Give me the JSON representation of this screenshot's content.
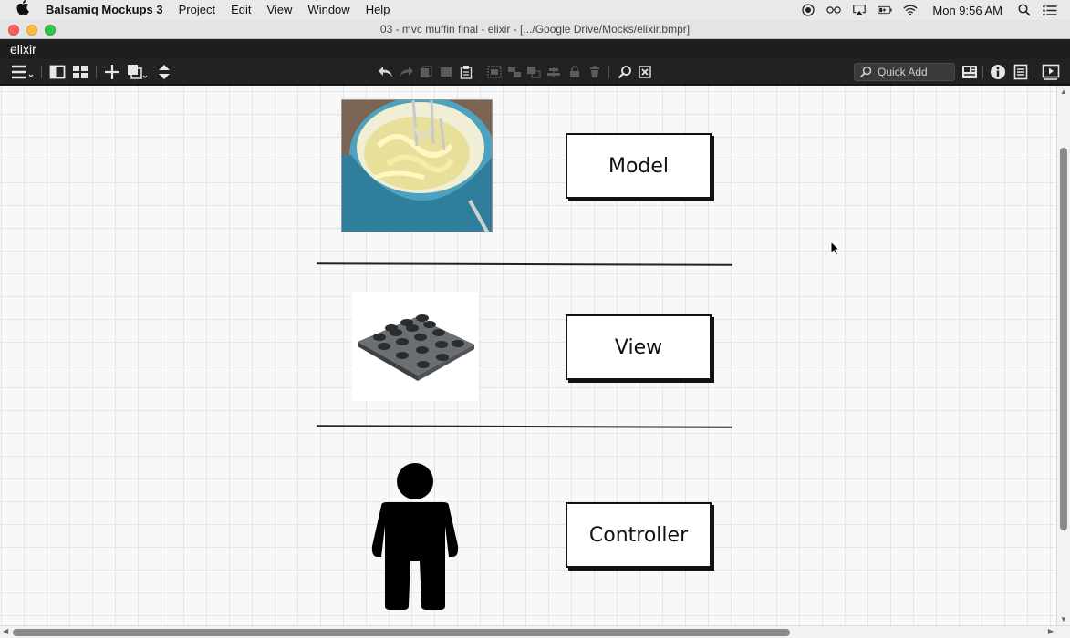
{
  "menubar": {
    "app_name": "Balsamiq Mockups 3",
    "items": [
      "Project",
      "Edit",
      "View",
      "Window",
      "Help"
    ],
    "clock": "Mon 9:56 AM",
    "status_icons": [
      "record-icon",
      "glasses-icon",
      "airplay-icon",
      "battery-icon",
      "wifi-icon",
      "spotlight-icon",
      "notification-center-icon"
    ]
  },
  "window": {
    "title": "03 - mvc muffin final - elixir - [.../Google Drive/Mocks/elixir.bmpr]"
  },
  "project": {
    "name": "elixir"
  },
  "toolbar": {
    "quick_add_placeholder": "Quick Add"
  },
  "mockup": {
    "boxes": {
      "model": "Model",
      "view": "View",
      "controller": "Controller"
    },
    "images": [
      "mixing-bowl-image",
      "muffin-tray-image",
      "person-icon"
    ]
  },
  "colors": {
    "menubar_bg": "#e9e9e9",
    "toolbar_bg": "#222222",
    "canvas_bg": "#f8f8f8",
    "traffic_close": "#fc605c",
    "traffic_min": "#fdbc40",
    "traffic_max": "#34c84a"
  }
}
